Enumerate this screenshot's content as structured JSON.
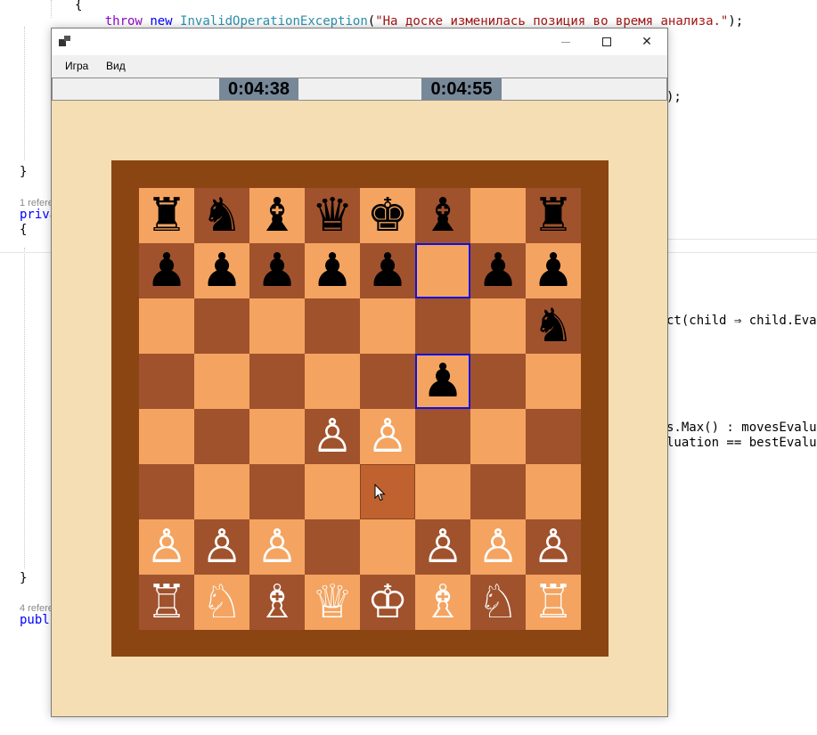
{
  "editor": {
    "line_throw": {
      "indent": "    ",
      "kw_throw": "throw",
      "kw_new": "new",
      "type": "InvalidOperationException",
      "str": "\"На доске изменилась позиция во время анализа.\"",
      "tail": ");"
    },
    "brace_open_top": "{",
    "right_fragment_1": ");",
    "brace_close_1": "}",
    "codelens_1": "1 refere",
    "priv": "priva",
    "brace_open_2": "{",
    "right_fragment_2": "ct(child ⇒ child.Evalu",
    "right_fragment_3": "s.Max() : movesEvaluati",
    "right_fragment_4": "luation == bestEvaluati",
    "brace_close_2": "}",
    "codelens_2": "4 refere",
    "publ": "publi"
  },
  "window": {
    "menu": [
      "Игра",
      "Вид"
    ],
    "controls": {
      "minimize": "minimize",
      "maximize": "maximize",
      "close": "✕"
    },
    "clocks": {
      "left": "0:04:38",
      "right": "0:04:55"
    }
  },
  "board": {
    "rows": [
      [
        "♜",
        "♞",
        "♝",
        "♛",
        "♚",
        "♝",
        "",
        "♜"
      ],
      [
        "♟",
        "♟",
        "♟",
        "♟",
        "♟",
        "",
        "♟",
        "♟"
      ],
      [
        "",
        "",
        "",
        "",
        "",
        "",
        "",
        "♞"
      ],
      [
        "",
        "",
        "",
        "",
        "",
        "♟",
        "",
        ""
      ],
      [
        "",
        "",
        "",
        "♙",
        "♙",
        "",
        "",
        ""
      ],
      [
        "",
        "",
        "",
        "",
        "",
        "",
        "",
        ""
      ],
      [
        "♙",
        "♙",
        "♙",
        "",
        "",
        "♙",
        "♙",
        "♙"
      ],
      [
        "♖",
        "♘",
        "♗",
        "♕",
        "♔",
        "♗",
        "♘",
        "♖"
      ]
    ],
    "colors": [
      [
        "b",
        "b",
        "b",
        "b",
        "b",
        "b",
        "",
        "b"
      ],
      [
        "b",
        "b",
        "b",
        "b",
        "b",
        "",
        "b",
        "b"
      ],
      [
        "",
        "",
        "",
        "",
        "",
        "",
        "",
        "b"
      ],
      [
        "",
        "",
        "",
        "",
        "",
        "b",
        "",
        ""
      ],
      [
        "",
        "",
        "",
        "w",
        "w",
        "",
        "",
        ""
      ],
      [
        "",
        "",
        "",
        "",
        "",
        "",
        "",
        ""
      ],
      [
        "w",
        "w",
        "w",
        "",
        "",
        "w",
        "w",
        "w"
      ],
      [
        "w",
        "w",
        "w",
        "w",
        "w",
        "w",
        "w",
        "w"
      ]
    ],
    "highlighted": [
      [
        1,
        5
      ],
      [
        3,
        5
      ]
    ],
    "hover": [
      5,
      4
    ],
    "light_color": "#f4a460",
    "dark_color": "#a0522d",
    "frame_color": "#8b4513"
  }
}
